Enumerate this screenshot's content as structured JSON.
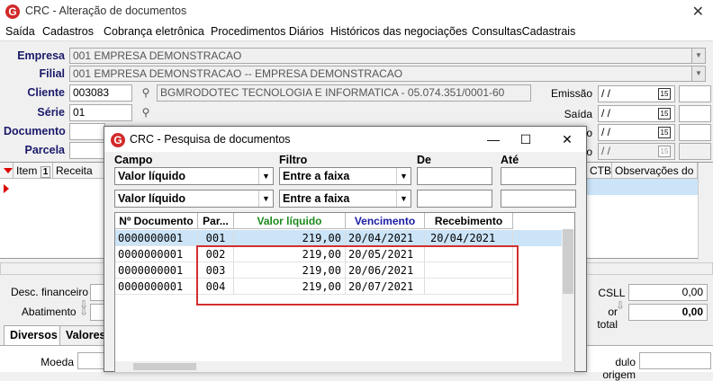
{
  "window": {
    "title": "CRC - Alteração de documentos",
    "logo": "G"
  },
  "menu": [
    "Saída",
    "Cadastros",
    "Cobrança eletrônica",
    "Procedimentos Diários",
    "Históricos das negociações",
    "ConsultasCadastrais"
  ],
  "form": {
    "empresa_label": "Empresa",
    "empresa_value": "001 EMPRESA DEMONSTRACAO",
    "filial_label": "Filial",
    "filial_value": "001 EMPRESA DEMONSTRACAO -- EMPRESA DEMONSTRACAO",
    "cliente_label": "Cliente",
    "cliente_value": "003083",
    "cliente_name": "BGMRODOTEC TECNOLOGIA  E INFORMATICA - 05.074.351/0001-60",
    "serie_label": "Série",
    "serie_value": "01",
    "documento_label": "Documento",
    "parcela_label": "Parcela",
    "emissao_label": "Emissão",
    "emissao_value": "/ /",
    "saida_label": "Saída",
    "saida_value": "/ /",
    "third_date_label": "o",
    "third_date_value": "/ /",
    "fourth_date_label": "o",
    "fourth_date_value": "/ /"
  },
  "grid": {
    "col_item": "Item",
    "col_item_sort": "1",
    "col_receita": "Receita",
    "col_ctb": "CTB",
    "col_obs": "Observações do ite"
  },
  "bottom": {
    "desc_fin_label": "Desc. financeiro",
    "abatimento_label": "Abatimento",
    "csll_label": "CSLL",
    "csll_value": "0,00",
    "total_label": "or total",
    "total_value": "0,00",
    "tab_diversos": "Diversos",
    "tab_valores": "Valores",
    "moeda_label": "Moeda",
    "titulo_origem_label": "dulo origem"
  },
  "dialog": {
    "title": "CRC - Pesquisa de documentos",
    "logo": "G",
    "hdr_campo": "Campo",
    "hdr_filtro": "Filtro",
    "hdr_de": "De",
    "hdr_ate": "Até",
    "filters": [
      {
        "campo": "Valor líquido",
        "filtro": "Entre a faixa"
      },
      {
        "campo": "Valor líquido",
        "filtro": "Entre a faixa"
      }
    ],
    "columns": {
      "numero": "Nº Documento",
      "parcela": "Par...",
      "valor": "Valor líquido",
      "vencimento": "Vencimento",
      "recebimento": "Recebimento"
    },
    "column_colors": {
      "valor": "#1c8a1c",
      "vencimento": "#1a1aa6",
      "recebimento": "#000000"
    },
    "rows": [
      {
        "numero": "0000000001",
        "parcela": "001",
        "valor": "219,00",
        "vencimento": "20/04/2021",
        "recebimento": "20/04/2021",
        "selected": true
      },
      {
        "numero": "0000000001",
        "parcela": "002",
        "valor": "219,00",
        "vencimento": "20/05/2021",
        "recebimento": ""
      },
      {
        "numero": "0000000001",
        "parcela": "003",
        "valor": "219,00",
        "vencimento": "20/06/2021",
        "recebimento": ""
      },
      {
        "numero": "0000000001",
        "parcela": "004",
        "valor": "219,00",
        "vencimento": "20/07/2021",
        "recebimento": ""
      }
    ],
    "selection_color": "#cce4f7",
    "highlight_color": "#d32f2f"
  }
}
